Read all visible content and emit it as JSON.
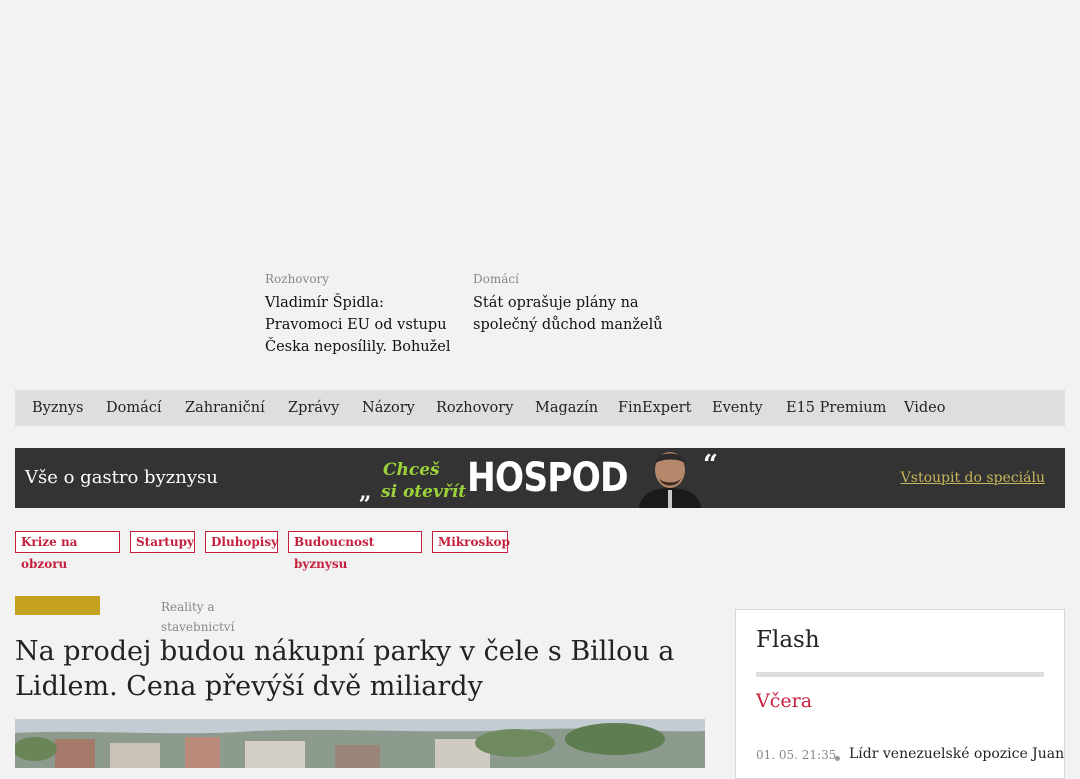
{
  "teasers": [
    {
      "category": "Rozhovory",
      "title": "Vladimír Špidla: Pravomoci EU od vstupu Česka neposílily. Bohužel"
    },
    {
      "category": "Domácí",
      "title": "Stát oprašuje plány na společný důchod manželů"
    }
  ],
  "nav": [
    "Byznys",
    "Domácí",
    "Zahraniční",
    "Zprávy",
    "Názory",
    "Rozhovory",
    "Magazín",
    "FinExpert",
    "Eventy",
    "E15 Premium",
    "Video"
  ],
  "banner": {
    "title": "Vše o gastro byznysu",
    "slogan_line1": "Chceš",
    "slogan_line2": "si otevřít",
    "brand": "HOSPODU",
    "link": "Vstoupit do speciálu"
  },
  "tags": [
    {
      "line1": "Krize na",
      "line2": "obzoru"
    },
    {
      "line1": "Startupy",
      "line2": ""
    },
    {
      "line1": "Dluhopisy",
      "line2": ""
    },
    {
      "line1": "Budoucnost",
      "line2": "byznysu"
    },
    {
      "line1": "Mikroskop",
      "line2": ""
    }
  ],
  "article": {
    "category": "Reality a stavebnictví",
    "headline": "Na prodej budou nákupní parky v čele s Billou a Lidlem. Cena převýší dvě miliardy"
  },
  "flash": {
    "title": "Flash",
    "day": "Včera",
    "items": [
      {
        "time": "01. 05. 21:35",
        "text": "Lídr venezuelské opozice Juan"
      }
    ]
  },
  "colors": {
    "accent_red": "#c5203d",
    "label_gold": "#c4a21f",
    "banner_bg": "#333333",
    "banner_link": "#c7b65a",
    "slogan_green": "#9bd23a"
  }
}
